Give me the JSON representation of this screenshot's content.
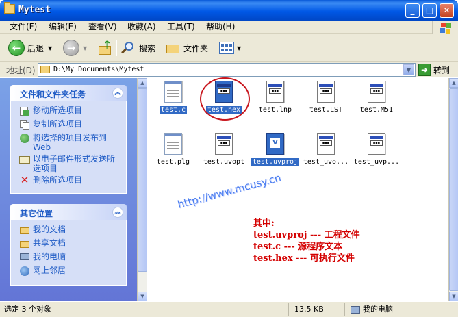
{
  "window": {
    "title": "Mytest"
  },
  "menu": [
    "文件(F)",
    "编辑(E)",
    "查看(V)",
    "收藏(A)",
    "工具(T)",
    "帮助(H)"
  ],
  "toolbar": {
    "back": "后退",
    "search": "搜索",
    "folders": "文件夹"
  },
  "address": {
    "label": "地址(D)",
    "path": "D:\\My Documents\\Mytest",
    "go": "转到"
  },
  "tasks_panel": {
    "title": "文件和文件夹任务",
    "items": [
      {
        "label": "移动所选项目",
        "icon": "move-icon"
      },
      {
        "label": "复制所选项目",
        "icon": "copy-icon"
      },
      {
        "label": "将选择的项目发布到 Web",
        "icon": "publish-web-icon"
      },
      {
        "label": "以电子邮件形式发送所选项目",
        "icon": "email-icon"
      },
      {
        "label": "删除所选项目",
        "icon": "delete-icon"
      }
    ]
  },
  "places_panel": {
    "title": "其它位置",
    "items": [
      {
        "label": "我的文档",
        "icon": "my-documents-icon"
      },
      {
        "label": "共享文档",
        "icon": "shared-documents-icon"
      },
      {
        "label": "我的电脑",
        "icon": "my-computer-icon"
      },
      {
        "label": "网上邻居",
        "icon": "network-places-icon"
      }
    ]
  },
  "files": [
    {
      "name": "test.c",
      "type": "notepad",
      "selected": true
    },
    {
      "name": "test.hex",
      "type": "app",
      "selected": true
    },
    {
      "name": "test.lnp",
      "type": "app",
      "selected": false
    },
    {
      "name": "test.LST",
      "type": "app",
      "selected": false
    },
    {
      "name": "test.M51",
      "type": "app",
      "selected": false
    },
    {
      "name": "test.plg",
      "type": "notepad",
      "selected": false
    },
    {
      "name": "test.uvopt",
      "type": "app",
      "selected": false
    },
    {
      "name": "test.uvproj",
      "type": "uvision",
      "selected": true
    },
    {
      "name": "test_uvo...",
      "type": "app",
      "selected": false
    },
    {
      "name": "test_uvp...",
      "type": "app",
      "selected": false
    }
  ],
  "watermark": "http://www.mcusy.cn",
  "note": {
    "heading": "其中:",
    "lines": [
      "test.uvproj --- 工程文件",
      "test.c --- 源程序文本",
      "test.hex --- 可执行文件"
    ]
  },
  "status": {
    "selection": "选定 3 个对象",
    "size": "13.5 KB",
    "location": "我的电脑"
  },
  "colors": {
    "title_blue": "#0058e6",
    "link_blue": "#215dc6",
    "selection": "#316ac5",
    "note_red": "#d40000",
    "ring_red": "#c8161d"
  }
}
